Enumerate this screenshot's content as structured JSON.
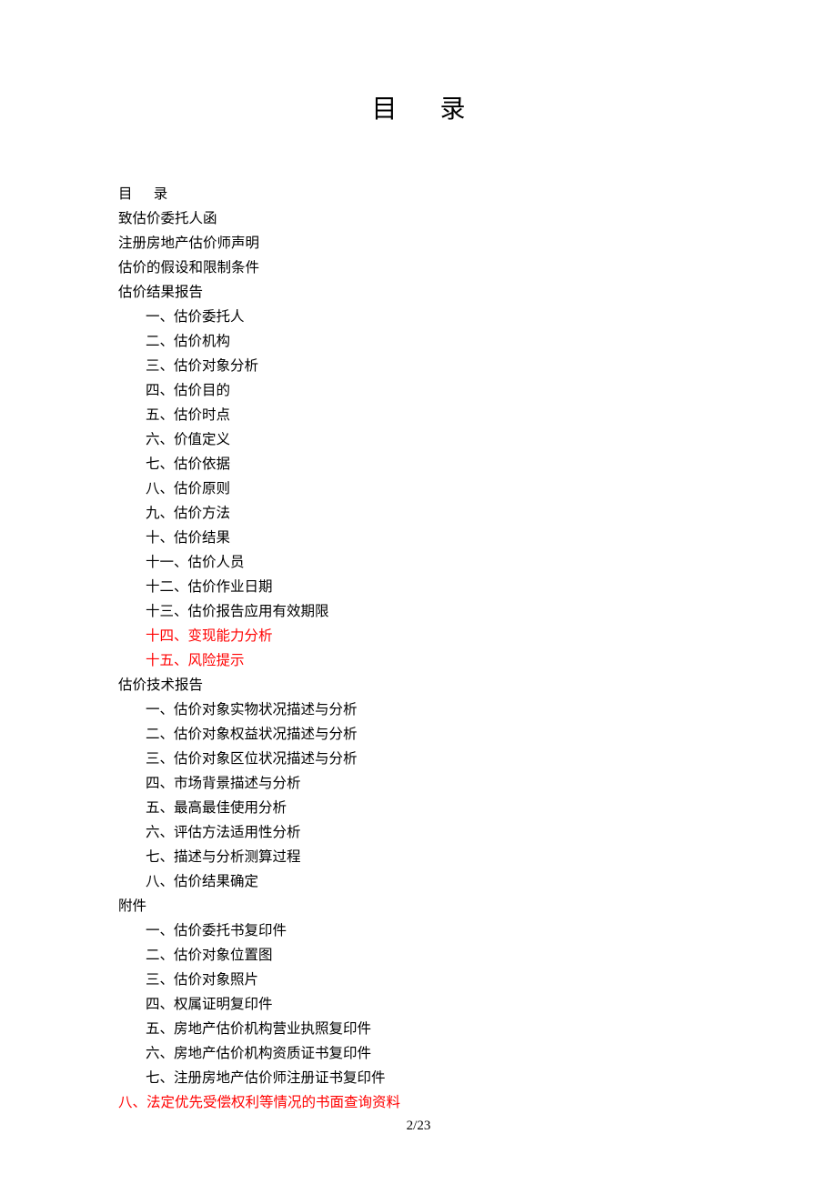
{
  "title": "目  录",
  "pageNumber": "2/23",
  "toc": {
    "top": [
      {
        "text": "目      录",
        "red": false,
        "indent": 0
      },
      {
        "text": "致估价委托人函",
        "red": false,
        "indent": 0
      },
      {
        "text": "注册房地产估价师声明",
        "red": false,
        "indent": 0
      },
      {
        "text": "估价的假设和限制条件",
        "red": false,
        "indent": 0
      },
      {
        "text": "估价结果报告",
        "red": false,
        "indent": 0
      },
      {
        "text": "一、估价委托人",
        "red": false,
        "indent": 1
      },
      {
        "text": "二、估价机构",
        "red": false,
        "indent": 1
      },
      {
        "text": "三、估价对象分析",
        "red": false,
        "indent": 1
      },
      {
        "text": "四、估价目的",
        "red": false,
        "indent": 1
      },
      {
        "text": "五、估价时点",
        "red": false,
        "indent": 1
      },
      {
        "text": "六、价值定义",
        "red": false,
        "indent": 1
      },
      {
        "text": "七、估价依据",
        "red": false,
        "indent": 1
      },
      {
        "text": "八、估价原则",
        "red": false,
        "indent": 1
      },
      {
        "text": "九、估价方法",
        "red": false,
        "indent": 1
      },
      {
        "text": "十、估价结果",
        "red": false,
        "indent": 1
      },
      {
        "text": "十一、估价人员",
        "red": false,
        "indent": 1
      },
      {
        "text": "十二、估价作业日期",
        "red": false,
        "indent": 1
      },
      {
        "text": "十三、估价报告应用有效期限",
        "red": false,
        "indent": 1
      },
      {
        "text": "十四、变现能力分析",
        "red": true,
        "indent": 1
      },
      {
        "text": "十五、风险提示",
        "red": true,
        "indent": 1
      },
      {
        "text": "估价技术报告",
        "red": false,
        "indent": 0
      },
      {
        "text": "一、估价对象实物状况描述与分析",
        "red": false,
        "indent": 1
      },
      {
        "text": "二、估价对象权益状况描述与分析",
        "red": false,
        "indent": 1
      },
      {
        "text": "三、估价对象区位状况描述与分析",
        "red": false,
        "indent": 1
      },
      {
        "text": "四、市场背景描述与分析",
        "red": false,
        "indent": 1
      },
      {
        "text": "五、最高最佳使用分析",
        "red": false,
        "indent": 1
      },
      {
        "text": "六、评估方法适用性分析",
        "red": false,
        "indent": 1
      },
      {
        "text": "七、描述与分析测算过程",
        "red": false,
        "indent": 1
      },
      {
        "text": "八、估价结果确定",
        "red": false,
        "indent": 1
      },
      {
        "text": "附件",
        "red": false,
        "indent": 0
      },
      {
        "text": "一、估价委托书复印件",
        "red": false,
        "indent": 1
      },
      {
        "text": "二、估价对象位置图",
        "red": false,
        "indent": 1
      },
      {
        "text": "三、估价对象照片",
        "red": false,
        "indent": 1
      },
      {
        "text": "四、权属证明复印件",
        "red": false,
        "indent": 1
      },
      {
        "text": "五、房地产估价机构营业执照复印件",
        "red": false,
        "indent": 1
      },
      {
        "text": "六、房地产估价机构资质证书复印件",
        "red": false,
        "indent": 1
      },
      {
        "text": "七、注册房地产估价师注册证书复印件",
        "red": false,
        "indent": 1
      },
      {
        "text": "八、法定优先受偿权利等情况的书面查询资料",
        "red": true,
        "indent": 0
      }
    ]
  }
}
